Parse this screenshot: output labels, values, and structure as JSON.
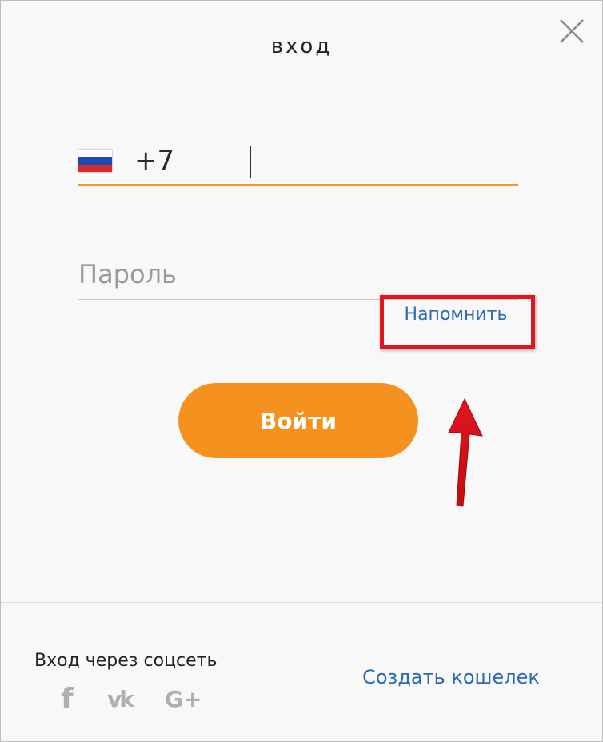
{
  "dialog": {
    "title": "вход",
    "close_icon": "close-icon"
  },
  "phone": {
    "country_flag": "russia-flag-icon",
    "value": "+7"
  },
  "password": {
    "placeholder": "Пароль",
    "remind_label": "Напомнить"
  },
  "login_button": {
    "label": "Войти"
  },
  "footer": {
    "social_label": "Вход через соцсеть",
    "social_icons": {
      "facebook": "f",
      "vk": "vk",
      "google_plus": "G+"
    },
    "create_wallet_label": "Создать кошелек"
  },
  "colors": {
    "accent": "#f5911e",
    "link": "#2d6ab1",
    "highlight": "#e0161e"
  }
}
